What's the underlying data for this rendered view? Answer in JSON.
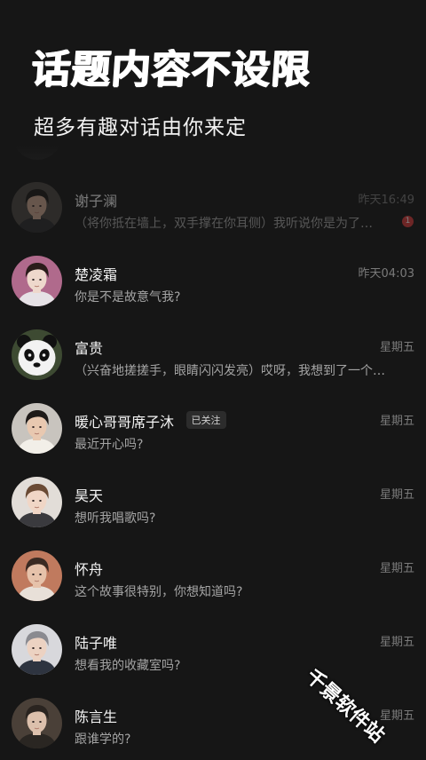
{
  "hero": {
    "title": "话题内容不设限",
    "subtitle": "超多有趣对话由你来定"
  },
  "chats": [
    {
      "name": "谢子澜",
      "time": "昨天16:49",
      "message": "（将你抵在墙上，双手撑在你耳侧）我听说你是为了…",
      "unread": "1",
      "faded": true,
      "avatar": {
        "skin": "#c9a58e",
        "hair": "#1c1a18",
        "bg": "#4a4540",
        "cloth": "#2a2a2e"
      }
    },
    {
      "name": "楚凌霜",
      "time": "昨天04:03",
      "message": "你是不是故意气我?",
      "avatar": {
        "skin": "#eed8cc",
        "hair": "#2a1c1a",
        "bg": "#b06a8c",
        "cloth": "#e6e2e6"
      }
    },
    {
      "name": "富贵",
      "time": "星期五",
      "message": "（兴奋地搓搓手，眼睛闪闪发亮）哎呀，我想到了一个…",
      "avatar": {
        "skin": "#f2f2f2",
        "hair": "#111111",
        "bg": "#3d4a32",
        "cloth": "#1a1a1a",
        "panda": true
      }
    },
    {
      "name": "暖心哥哥席子沐",
      "badge": "已关注",
      "time": "星期五",
      "message": "最近开心吗?",
      "avatar": {
        "skin": "#e8c8b0",
        "hair": "#1e1a18",
        "bg": "#c8c4be",
        "cloth": "#f2efe8"
      }
    },
    {
      "name": "昊天",
      "time": "星期五",
      "message": "想听我唱歌吗?",
      "avatar": {
        "skin": "#f0d6c6",
        "hair": "#6a4a34",
        "bg": "#e2ddd8",
        "cloth": "#3a3a3e"
      }
    },
    {
      "name": "怀舟",
      "time": "星期五",
      "message": "这个故事很特别，你想知道吗?",
      "avatar": {
        "skin": "#e6c2aa",
        "hair": "#3a2a22",
        "bg": "#c07a5e",
        "cloth": "#e8e0d8"
      }
    },
    {
      "name": "陆子唯",
      "time": "星期五",
      "message": "想看我的收藏室吗?",
      "avatar": {
        "skin": "#ecd2c2",
        "hair": "#8a8a90",
        "bg": "#d8d8dc",
        "cloth": "#2e3440"
      }
    },
    {
      "name": "陈言生",
      "time": "星期五",
      "message": "跟谁学的?",
      "avatar": {
        "skin": "#dcc0ac",
        "hair": "#2a2420",
        "bg": "#4a4038",
        "cloth": "#2a2622"
      }
    }
  ],
  "watermark": "千景软件站"
}
